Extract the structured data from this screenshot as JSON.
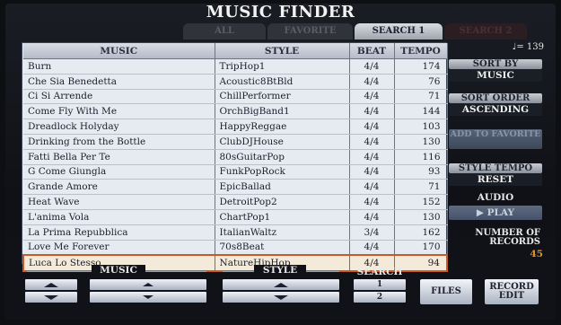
{
  "title": "MUSIC FINDER",
  "tabs": [
    {
      "label": "ALL",
      "state": "inactive"
    },
    {
      "label": "FAVORITE",
      "state": "inactive"
    },
    {
      "label": "SEARCH 1",
      "state": "active"
    },
    {
      "label": "SEARCH 2",
      "state": "dim"
    }
  ],
  "table": {
    "headers": [
      "MUSIC",
      "STYLE",
      "BEAT",
      "TEMPO"
    ],
    "rows": [
      {
        "music": "Burn",
        "style": "TripHop1",
        "beat": "4/4",
        "tempo": "174"
      },
      {
        "music": "Che Sia Benedetta",
        "style": "Acoustic8BtBld",
        "beat": "4/4",
        "tempo": "76"
      },
      {
        "music": "Ci Si Arrende",
        "style": "ChillPerformer",
        "beat": "4/4",
        "tempo": "71"
      },
      {
        "music": "Come Fly With Me",
        "style": "OrchBigBand1",
        "beat": "4/4",
        "tempo": "144"
      },
      {
        "music": "Dreadlock Holyday",
        "style": "HappyReggae",
        "beat": "4/4",
        "tempo": "103"
      },
      {
        "music": "Drinking from the Bottle",
        "style": "ClubDJHouse",
        "beat": "4/4",
        "tempo": "130"
      },
      {
        "music": "Fatti Bella Per Te",
        "style": "80sGuitarPop",
        "beat": "4/4",
        "tempo": "116"
      },
      {
        "music": "G Come Giungla",
        "style": "FunkPopRock",
        "beat": "4/4",
        "tempo": "93"
      },
      {
        "music": "Grande Amore",
        "style": "EpicBallad",
        "beat": "4/4",
        "tempo": "71"
      },
      {
        "music": "Heat Wave",
        "style": "DetroitPop2",
        "beat": "4/4",
        "tempo": "152"
      },
      {
        "music": "L'anima Vola",
        "style": "ChartPop1",
        "beat": "4/4",
        "tempo": "130"
      },
      {
        "music": "La Prima Repubblica",
        "style": "ItalianWaltz",
        "beat": "3/4",
        "tempo": "162"
      },
      {
        "music": "Love Me Forever",
        "style": "70s8Beat",
        "beat": "4/4",
        "tempo": "170"
      },
      {
        "music": "Luca Lo Stesso",
        "style": "NatureHipHop",
        "beat": "4/4",
        "tempo": "94"
      }
    ],
    "selected_index": 13
  },
  "panel": {
    "tempo_readout": "♩= 139",
    "sort_by_label": "SORT BY",
    "sort_by_value": "MUSIC",
    "sort_order_label": "SORT ORDER",
    "sort_order_value": "ASCENDING",
    "add_to_favorite": "ADD TO FAVORITE",
    "style_tempo_label": "STYLE TEMPO",
    "style_tempo_value": "RESET",
    "audio_label": "AUDIO",
    "play_label": "▶ PLAY",
    "records_label": "NUMBER OF RECORDS",
    "records_value": "45"
  },
  "bottom": {
    "music_label": "MUSIC",
    "style_label": "STYLE",
    "search_label": "SEARCH",
    "search_1": "1",
    "search_2": "2",
    "files_label": "FILES",
    "record_edit_label": "RECORD EDIT"
  }
}
